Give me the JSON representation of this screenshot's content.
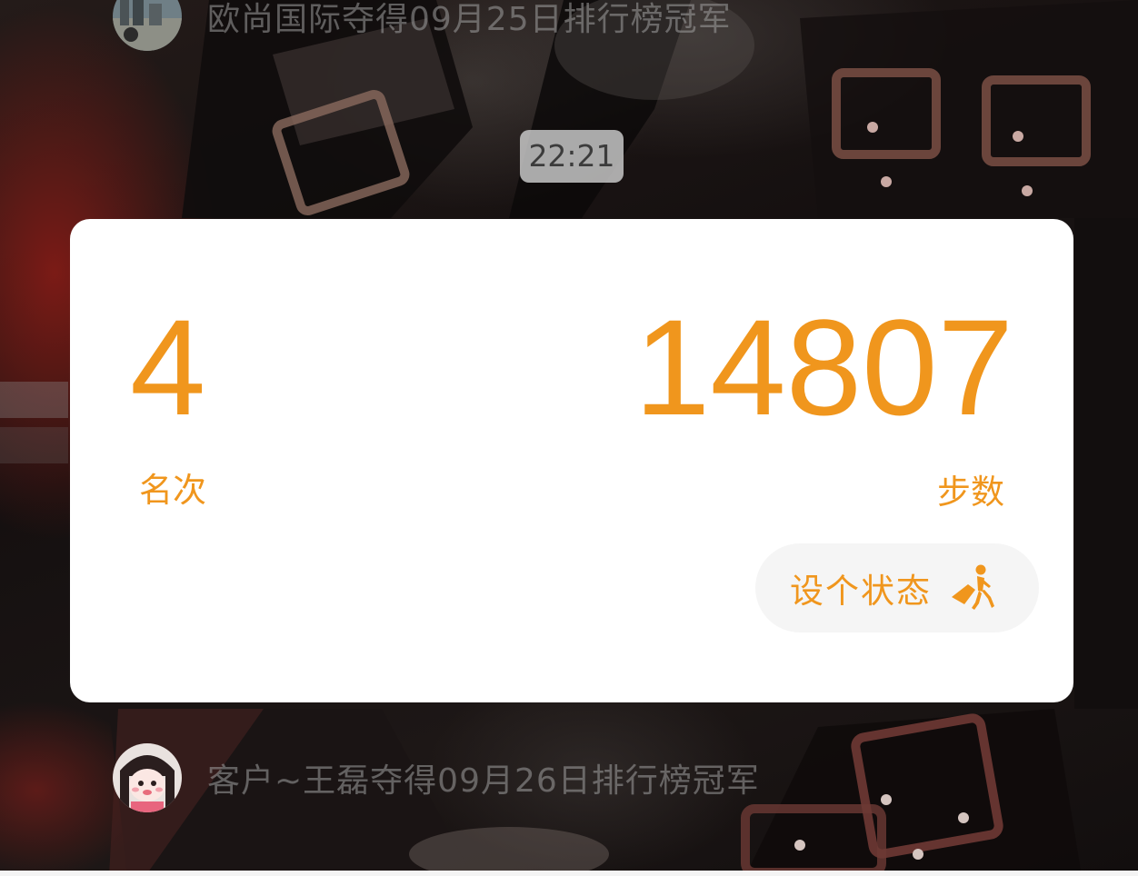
{
  "colors": {
    "accent": "#f0961d",
    "card_background": "#ffffff",
    "status_button_background": "#f5f5f5",
    "time_chip_background": "#cdcdcd"
  },
  "notices": {
    "top": {
      "text": "欧尚国际夺得09月25日排行榜冠军",
      "avatar_icon": "avatar-photo-city"
    },
    "bottom": {
      "text": "客户~王磊夺得09月26日排行榜冠军",
      "avatar_icon": "avatar-cartoon-girl"
    }
  },
  "time_chip": {
    "time": "22:21"
  },
  "card": {
    "rank": {
      "value": "4",
      "label": "名次"
    },
    "steps": {
      "value": "14807",
      "label": "步数"
    },
    "status_button": {
      "label": "设个状态",
      "icon": "runner-icon"
    }
  }
}
